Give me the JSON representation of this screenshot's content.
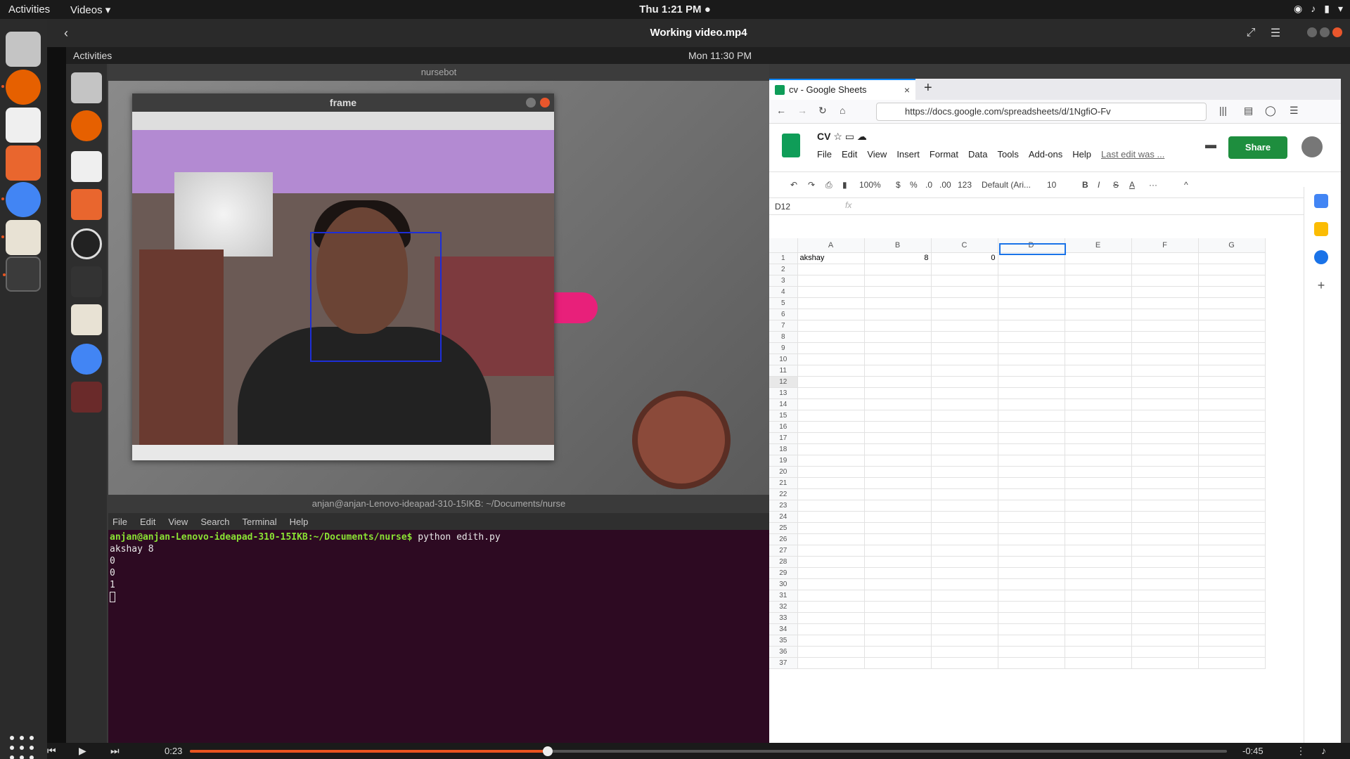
{
  "topbar": {
    "activities": "Activities",
    "app_menu": "Videos ▾",
    "clock": "Thu  1:21 PM ●",
    "tray_icons": [
      "wifi-icon",
      "volume-icon",
      "battery-icon",
      "chevron-down-icon"
    ]
  },
  "player": {
    "title": "Working video.mp4",
    "time_current": "0:23",
    "time_remaining": "-0:45",
    "progress": 0.345
  },
  "inner": {
    "topbar": {
      "activities": "Activities",
      "clock": "Mon 11:30 PM"
    },
    "nursebot": {
      "title": "nursebot",
      "back_button": "back"
    },
    "frame_window": {
      "title": "frame"
    },
    "terminal": {
      "title": "anjan@anjan-Lenovo-ideapad-310-15IKB: ~/Documents/nurse",
      "menu": [
        "File",
        "Edit",
        "View",
        "Search",
        "Terminal",
        "Help"
      ],
      "prompt": "anjan@anjan-Lenovo-ideapad-310-15IKB:~/Documents/nurse$",
      "command": " python edith.py",
      "output": [
        "akshay 8",
        "0",
        "0",
        "1"
      ]
    },
    "browser": {
      "tab_title": "cv - Google Sheets",
      "url": "https://docs.google.com/spreadsheets/d/1NgfiO-Fv",
      "sheets": {
        "doc_title": "CV",
        "menu": [
          "File",
          "Edit",
          "View",
          "Insert",
          "Format",
          "Data",
          "Tools",
          "Add-ons",
          "Help"
        ],
        "last_edit": "Last edit was ...",
        "share_label": "Share",
        "toolbar": {
          "zoom": "100%",
          "currency": "$",
          "percent": "%",
          "dec_less": ".0",
          "dec_more": ".00",
          "format_more": "123",
          "font": "Default (Ari...",
          "font_size": "10",
          "bold": "B",
          "italic": "I",
          "strike": "S",
          "text_color": "A",
          "more": "···"
        },
        "cell_ref": "D12",
        "fx": "fx",
        "columns": [
          "A",
          "B",
          "C",
          "D",
          "E",
          "F",
          "G"
        ],
        "rows": [
          [
            "akshay",
            "8",
            "0",
            "",
            "",
            "",
            ""
          ]
        ],
        "row_count": 37,
        "selected_cell": "D12"
      }
    }
  },
  "colors": {
    "accent": "#e95420",
    "back_pill": "#e8207a",
    "share": "#1e8e3e",
    "terminal_bg": "#2d0a22"
  }
}
